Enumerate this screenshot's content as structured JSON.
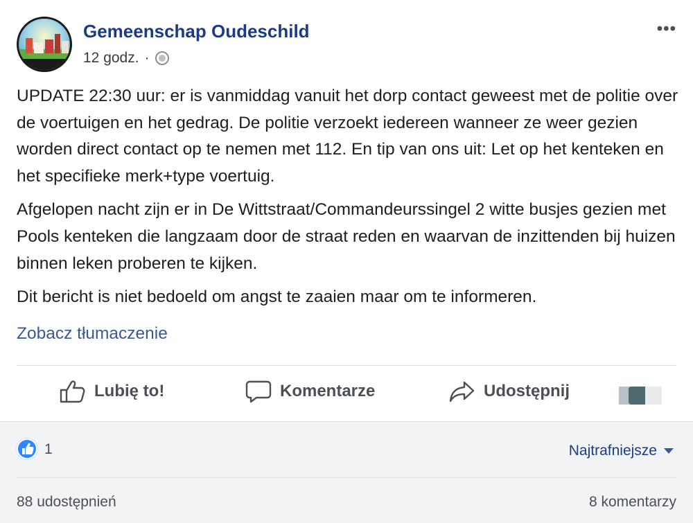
{
  "post": {
    "page_name": "Gemeenschap Oudeschild",
    "avatar_text": "Gemeenschap Oudeschild",
    "timestamp": "12 godz.",
    "separator": "·",
    "privacy_icon": "globe-icon",
    "more_label": "•••",
    "paragraphs": [
      "UPDATE 22:30 uur: er is vanmiddag vanuit het dorp contact geweest met de politie over de voertuigen en het gedrag. De politie verzoekt iedereen wanneer ze weer gezien worden direct contact op te nemen met 112. En tip van ons uit: Let op het kenteken en het specifieke merk+type voertuig.",
      "Afgelopen nacht zijn er in De Wittstraat/Commandeurssingel 2 witte busjes gezien met Pools kenteken die langzaam door de straat reden en waarvan de inzittenden bij huizen binnen leken proberen te kijken.",
      "Dit bericht is niet bedoeld om angst te zaaien maar om te informeren."
    ],
    "translate_link": "Zobacz tłumaczenie"
  },
  "actions": {
    "like": {
      "label": "Lubię to!",
      "icon": "thumbs-up-icon"
    },
    "comment": {
      "label": "Komentarze",
      "icon": "comment-icon"
    },
    "share": {
      "label": "Udostępnij",
      "icon": "share-arrow-icon"
    }
  },
  "footer": {
    "like_count": "1",
    "sort_label": "Najtrafniejsze",
    "shares": "88 udostępnień",
    "comments": "8 komentarzy"
  },
  "colors": {
    "page_name": "#1b3b8a",
    "link": "#385898",
    "like_blue": "#2d88ff",
    "footer_bg": "#f2f3f5"
  }
}
